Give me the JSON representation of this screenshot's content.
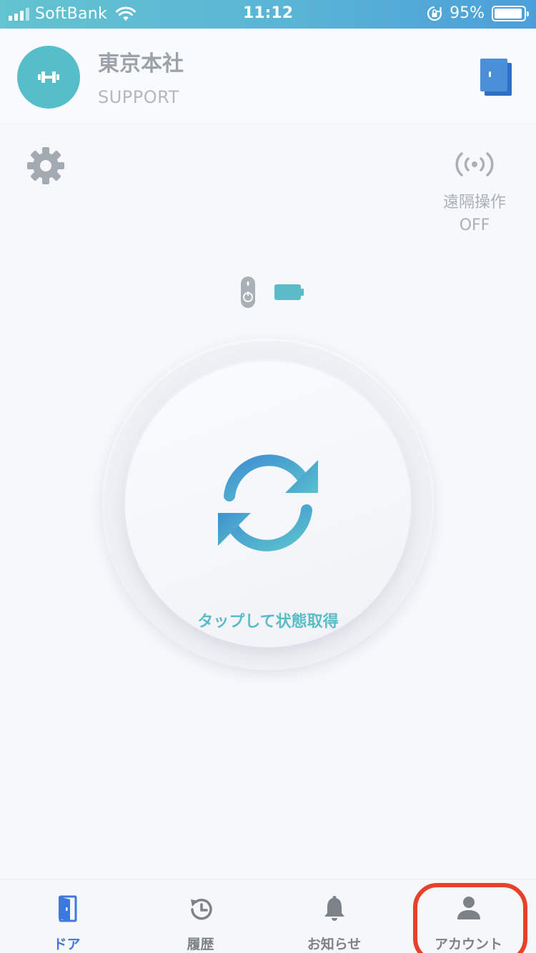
{
  "status_bar": {
    "carrier": "SoftBank",
    "time": "11:12",
    "battery_percent": "95%",
    "battery_level": 0.95
  },
  "header": {
    "org_name": "東京本社",
    "org_sub": "SUPPORT",
    "avatar_icon": "dumbbell-icon",
    "switch_icon": "door-switch-icon"
  },
  "main": {
    "settings_icon": "gear-icon",
    "remote": {
      "icon": "broadcast-icon",
      "label_line1": "遠隔操作",
      "label_line2": "OFF"
    },
    "device_status": {
      "device_icon": "lock-device-icon",
      "battery_icon": "battery-full-icon"
    },
    "action_button": {
      "icon": "refresh-icon",
      "label": "タップして状態取得"
    }
  },
  "tabbar": {
    "tabs": [
      {
        "label": "ドア",
        "icon": "door-icon",
        "active": true
      },
      {
        "label": "履歴",
        "icon": "history-icon",
        "active": false
      },
      {
        "label": "お知らせ",
        "icon": "bell-icon",
        "active": false
      },
      {
        "label": "アカウント",
        "icon": "person-icon",
        "active": false
      }
    ]
  },
  "colors": {
    "accent": "#56bec8",
    "active_tab": "#3d78e0",
    "highlight": "#e8402a"
  }
}
